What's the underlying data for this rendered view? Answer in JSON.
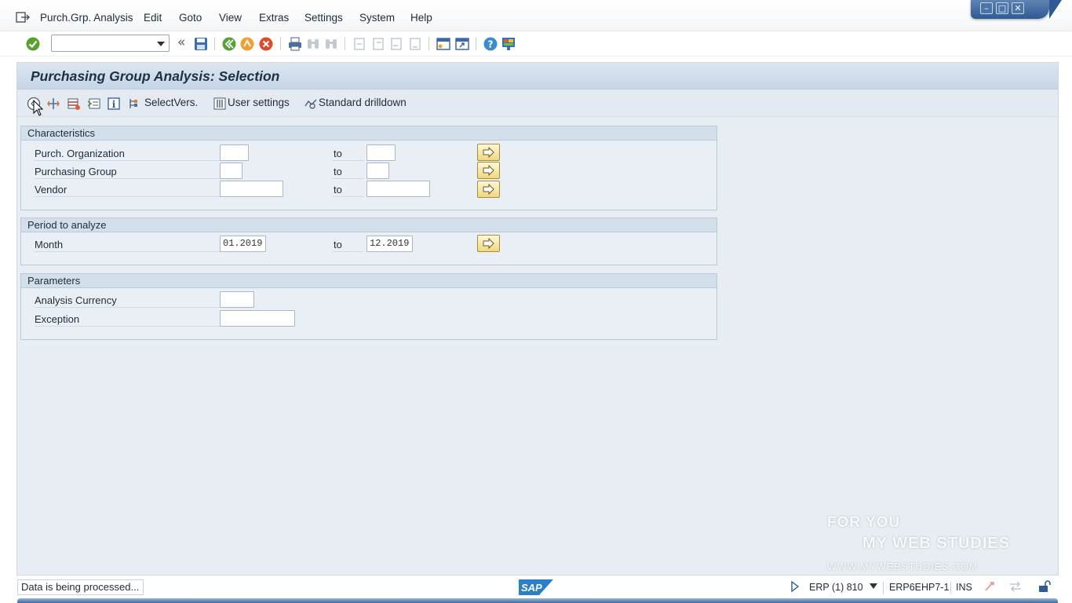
{
  "menu": {
    "items": [
      {
        "label": "Purch.Grp. Analysis"
      },
      {
        "label": "Edit"
      },
      {
        "label": "Goto"
      },
      {
        "label": "View"
      },
      {
        "label": "Extras"
      },
      {
        "label": "Settings"
      },
      {
        "label": "System"
      },
      {
        "label": "Help"
      }
    ]
  },
  "window_controls": {
    "minimize": "–",
    "maximize": "□",
    "close": "✕"
  },
  "command_field": {
    "value": ""
  },
  "title": "Purchasing Group Analysis: Selection",
  "app_toolbar": {
    "select_versions": "SelectVers.",
    "user_settings": "User settings",
    "standard_drilldown": "Standard drilldown"
  },
  "groups": {
    "characteristics": {
      "header": "Characteristics",
      "rows": [
        {
          "label": "Purch. Organization",
          "to": "to",
          "low": "",
          "high": ""
        },
        {
          "label": "Purchasing Group",
          "to": "to",
          "low": "",
          "high": ""
        },
        {
          "label": "Vendor",
          "to": "to",
          "low": "",
          "high": ""
        }
      ]
    },
    "period": {
      "header": "Period to analyze",
      "rows": [
        {
          "label": "Month",
          "to": "to",
          "low": "01.2019",
          "high": "12.2019"
        }
      ]
    },
    "parameters": {
      "header": "Parameters",
      "rows": [
        {
          "label": "Analysis Currency",
          "value": ""
        },
        {
          "label": "Exception",
          "value": ""
        }
      ]
    }
  },
  "status_bar": {
    "message": "Data is being processed...",
    "logo": "SAP",
    "system": "ERP (1) 810",
    "server": "ERP6EHP7-1",
    "mode": "INS"
  },
  "watermark": {
    "line1": "FOR YOU",
    "line2": "MY WEB STUDIES",
    "line3": "WWW.MYWEBSTUDIES.COM"
  },
  "colors": {
    "frame_background": "#e7edf3",
    "multiple_selection_button": "#f1d780",
    "window_controls": "#2f5a93"
  }
}
